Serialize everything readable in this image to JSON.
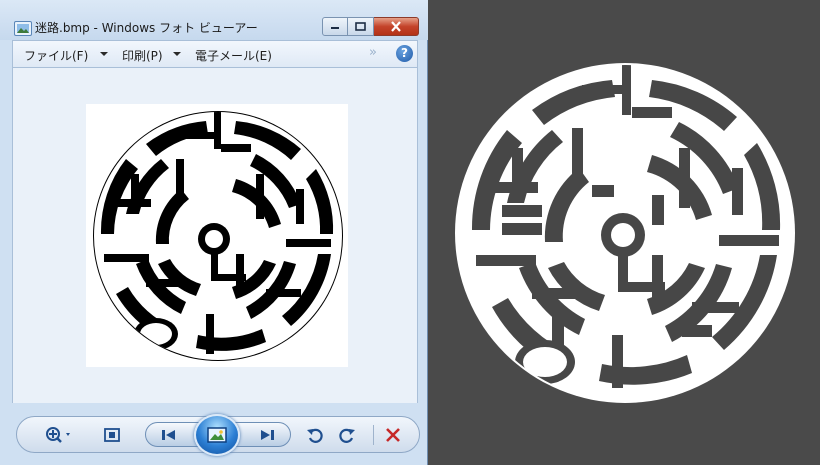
{
  "window": {
    "title": "迷路.bmp - Windows フォト ビューアー",
    "controls": {
      "minimize": "minimize",
      "maximize": "maximize",
      "close": "close"
    }
  },
  "menu": {
    "items": [
      {
        "label": "ファイル(F)"
      },
      {
        "label": "印刷(P)"
      },
      {
        "label": "電子メール(E)"
      }
    ],
    "overflow": "»",
    "help": "?"
  },
  "image": {
    "file_name": "迷路.bmp"
  },
  "toolbar": {
    "buttons": [
      "zoom-icon",
      "actual-size-icon",
      "previous-icon",
      "slideshow-icon",
      "next-icon",
      "rotate-left-icon",
      "rotate-right-icon",
      "delete-icon"
    ]
  },
  "colors": {
    "desktop_bg": "#4a4a4a",
    "window_frame": "#cfe0f2",
    "close_button": "#c4432a",
    "accent_blue": "#2c7fd4"
  }
}
